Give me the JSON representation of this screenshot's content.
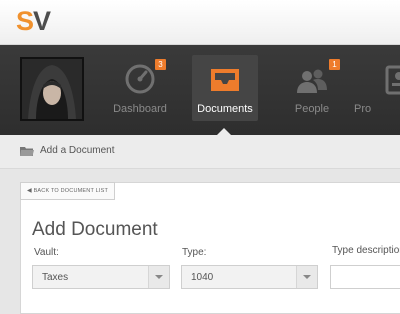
{
  "app": {
    "logo_s": "S",
    "logo_v": "V"
  },
  "nav": {
    "items": [
      {
        "label": "Dashboard",
        "badge": "3",
        "icon": "speedometer-icon"
      },
      {
        "label": "Documents",
        "badge": "",
        "icon": "inbox-tray-icon"
      },
      {
        "label": "People",
        "badge": "1",
        "icon": "people-icon"
      },
      {
        "label": "Pro",
        "badge": "",
        "icon": "profile-card-icon"
      }
    ]
  },
  "breadcrumb": {
    "label": "Add a Document",
    "icon": "folder-icon"
  },
  "form": {
    "back_label": "BACK TO DOCUMENT LIST",
    "title": "Add Document",
    "vault_label": "Vault:",
    "vault_value": "Taxes",
    "type_label": "Type:",
    "type_value": "1040",
    "type_description_label": "Type description"
  },
  "colors": {
    "accent": "#ee7c2c",
    "logo_orange": "#f0912e",
    "nav_bg": "#333333"
  }
}
